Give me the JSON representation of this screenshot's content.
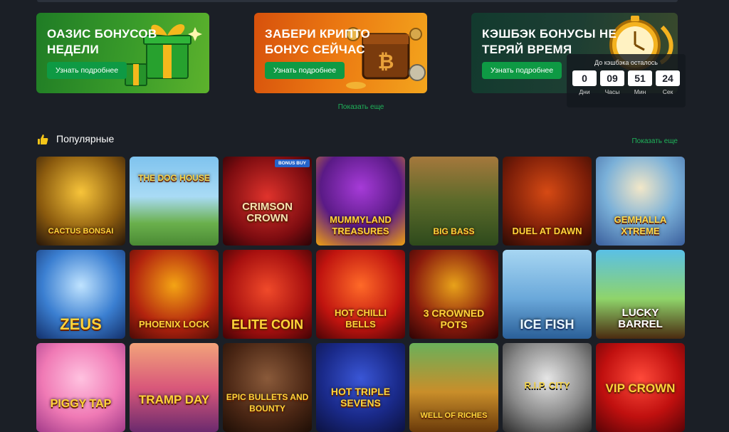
{
  "banners": [
    {
      "title": "ОАЗИС БОНУСОВ НЕДЕЛИ",
      "button": "Узнать подробнее"
    },
    {
      "title": "ЗАБЕРИ КРИПТО БОНУС СЕЙЧАС",
      "button": "Узнать подробнее"
    },
    {
      "title": "КЭШБЭК БОНУСЫ НЕ ТЕРЯЙ ВРЕМЯ",
      "button": "Узнать подробнее"
    }
  ],
  "cashback_timer": {
    "title": "До кэшбэка осталось",
    "cells": [
      {
        "value": "0",
        "label": "Дни"
      },
      {
        "value": "09",
        "label": "Часы"
      },
      {
        "value": "51",
        "label": "Мин"
      },
      {
        "value": "24",
        "label": "Сек"
      }
    ]
  },
  "banners_show_more": "Показать еще",
  "popular": {
    "title": "Популярные",
    "show_more": "Показать еще",
    "badge_bonus_buy": "BONUS BUY",
    "games": [
      {
        "name": "Cactus Bonsai"
      },
      {
        "name": "The Dog House"
      },
      {
        "name": "Crimson Crown"
      },
      {
        "name": "Mummyland Treasures"
      },
      {
        "name": "Big Bass"
      },
      {
        "name": "Duel at Dawn"
      },
      {
        "name": "Gemhalla Xtreme"
      },
      {
        "name": "Zeus"
      },
      {
        "name": "Phoenix Lock"
      },
      {
        "name": "Elite Coin"
      },
      {
        "name": "Hot Chilli Bells"
      },
      {
        "name": "3 Crowned Pots"
      },
      {
        "name": "Ice Fish"
      },
      {
        "name": "Lucky Barrel"
      },
      {
        "name": "Piggy Tap"
      },
      {
        "name": "Tramp Day"
      },
      {
        "name": "Epic Bullets and Bounty"
      },
      {
        "name": "Hot Triple Sevens"
      },
      {
        "name": "Well of Riches"
      },
      {
        "name": "R.I.P. City"
      },
      {
        "name": "VIP Crown"
      }
    ]
  },
  "colors": {
    "accent_green": "#1fb35a",
    "button_green": "#0e9a44",
    "background": "#1b1f26"
  }
}
